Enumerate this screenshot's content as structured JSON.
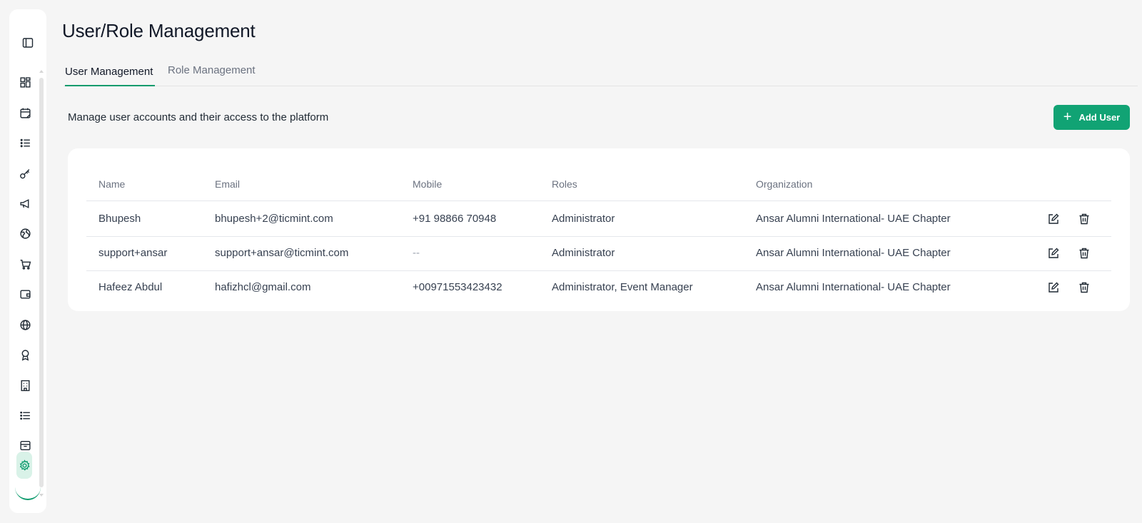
{
  "page": {
    "title": "User/Role Management",
    "subtitle": "Manage user accounts and their access to the platform"
  },
  "tabs": [
    {
      "label": "User Management",
      "active": true
    },
    {
      "label": "Role Management",
      "active": false
    }
  ],
  "actions": {
    "add_user_label": "Add User"
  },
  "sidebar": {
    "items": [
      {
        "icon": "dashboard-icon"
      },
      {
        "icon": "calendar-icon"
      },
      {
        "icon": "list-ordered-icon"
      },
      {
        "icon": "key-icon"
      },
      {
        "icon": "megaphone-icon"
      },
      {
        "icon": "globe-hands-icon"
      },
      {
        "icon": "cart-icon"
      },
      {
        "icon": "wallet-icon"
      },
      {
        "icon": "globe-icon"
      },
      {
        "icon": "award-icon"
      },
      {
        "icon": "building-icon"
      },
      {
        "icon": "list-icon"
      },
      {
        "icon": "archive-icon"
      },
      {
        "icon": "gear-icon",
        "active": true
      }
    ]
  },
  "table": {
    "columns": [
      "Name",
      "Email",
      "Mobile",
      "Roles",
      "Organization"
    ],
    "rows": [
      {
        "name": "Bhupesh",
        "email": "bhupesh+2@ticmint.com",
        "mobile": "+91 98866 70948",
        "roles": "Administrator",
        "organization": "Ansar Alumni International- UAE Chapter"
      },
      {
        "name": "support+ansar",
        "email": "support+ansar@ticmint.com",
        "mobile": "--",
        "roles": "Administrator",
        "organization": "Ansar Alumni International- UAE Chapter"
      },
      {
        "name": "Hafeez Abdul",
        "email": "hafizhcl@gmail.com",
        "mobile": "+00971553423432",
        "roles": "Administrator, Event Manager",
        "organization": "Ansar Alumni International- UAE Chapter"
      }
    ]
  },
  "colors": {
    "accent": "#11a374",
    "background": "#f5f5f5",
    "active_nav_bg": "#d9f2e8"
  }
}
